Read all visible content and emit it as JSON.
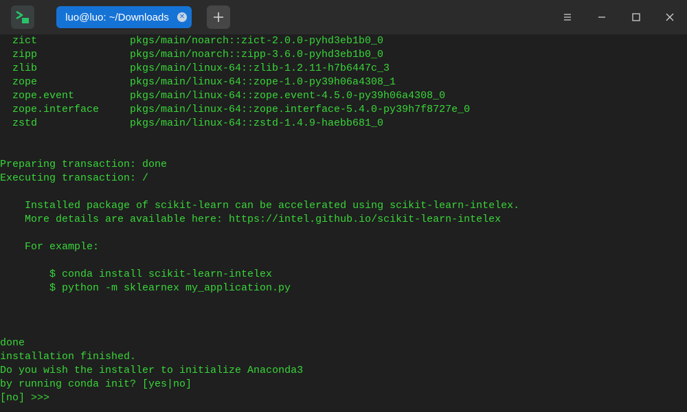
{
  "window": {
    "tab_title": "luo@luo: ~/Downloads",
    "icons": {
      "app": "terminal-app-icon",
      "tab_close": "close-icon",
      "new_tab": "plus-icon",
      "menu": "hamburger-menu-icon",
      "minimize": "minimize-icon",
      "maximize": "maximize-icon",
      "close": "close-icon"
    }
  },
  "colors": {
    "terminal_text": "#39d639",
    "tab_active": "#1673d6",
    "background": "#1f1f1f",
    "titlebar": "#2b2b2b"
  },
  "packages": [
    {
      "name": "zict",
      "source": "pkgs/main/noarch::zict-2.0.0-pyhd3eb1b0_0"
    },
    {
      "name": "zipp",
      "source": "pkgs/main/noarch::zipp-3.6.0-pyhd3eb1b0_0"
    },
    {
      "name": "zlib",
      "source": "pkgs/main/linux-64::zlib-1.2.11-h7b6447c_3"
    },
    {
      "name": "zope",
      "source": "pkgs/main/linux-64::zope-1.0-py39h06a4308_1"
    },
    {
      "name": "zope.event",
      "source": "pkgs/main/linux-64::zope.event-4.5.0-py39h06a4308_0"
    },
    {
      "name": "zope.interface",
      "source": "pkgs/main/linux-64::zope.interface-5.4.0-py39h7f8727e_0"
    },
    {
      "name": "zstd",
      "source": "pkgs/main/linux-64::zstd-1.4.9-haebb681_0"
    }
  ],
  "output": {
    "preparing": "Preparing transaction: done",
    "executing": "Executing transaction: /",
    "intelex_note_1": "Installed package of scikit-learn can be accelerated using scikit-learn-intelex.",
    "intelex_note_2": "More details are available here: https://intel.github.io/scikit-learn-intelex",
    "for_example": "For example:",
    "cmd_1": "$ conda install scikit-learn-intelex",
    "cmd_2": "$ python -m sklearnex my_application.py",
    "done": "done",
    "finished": "installation finished.",
    "question_1": "Do you wish the installer to initialize Anaconda3",
    "question_2": "by running conda init? [yes|no]",
    "prompt": "[no] >>>"
  }
}
